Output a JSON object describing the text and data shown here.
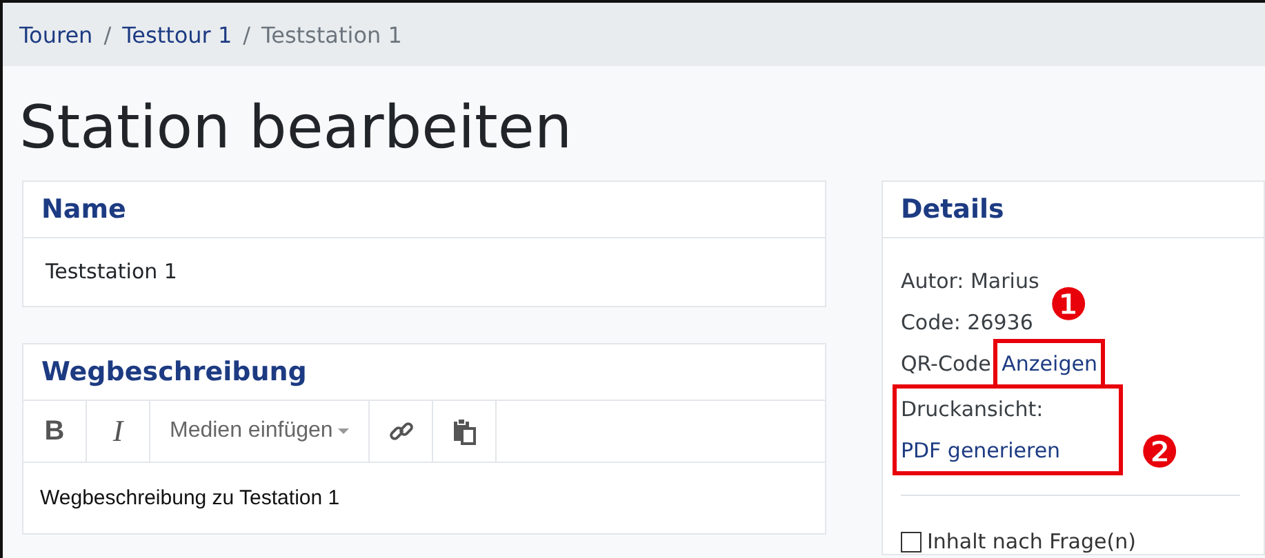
{
  "breadcrumb": [
    {
      "label": "Touren",
      "current": false
    },
    {
      "label": "Testtour 1",
      "current": false
    },
    {
      "label": "Teststation 1",
      "current": true
    }
  ],
  "separator": "/",
  "page_title": "Station bearbeiten",
  "name_card": {
    "title": "Name",
    "value": "Teststation 1"
  },
  "description_card": {
    "title": "Wegbeschreibung",
    "toolbar": [
      {
        "kind": "bold",
        "label": "B"
      },
      {
        "kind": "italic",
        "label": "I"
      },
      {
        "kind": "dropdown",
        "label": "Medien einfügen"
      },
      {
        "kind": "link"
      },
      {
        "kind": "paste"
      }
    ],
    "content": "Wegbeschreibung zu Testation 1"
  },
  "details_card": {
    "title": "Details",
    "lines": [
      {
        "text": "Autor: Marius",
        "highlighted": false
      },
      {
        "text": "Code: 26936",
        "highlighted": false,
        "callout": "❶"
      },
      {
        "text": "QR-Code",
        "link": "Anzeigen",
        "link_highlighted": true,
        "highlighted": false
      },
      {
        "text": "Druckansicht:",
        "link": "PDF generieren",
        "highlighted": true,
        "callout": "❷"
      }
    ],
    "checkbox": {
      "label": "Inhalt nach Frage(n)",
      "checked": false
    }
  }
}
